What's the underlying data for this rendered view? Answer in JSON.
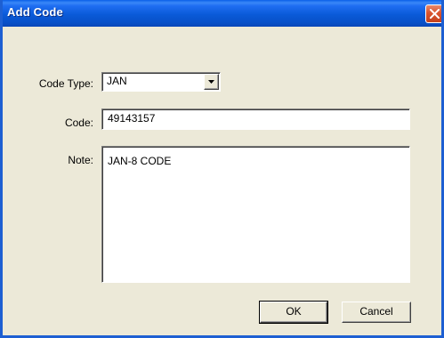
{
  "window": {
    "title": "Add Code"
  },
  "form": {
    "code_type_label": "Code Type:",
    "code_type_value": "JAN",
    "code_label": "Code:",
    "code_value": "49143157",
    "note_label": "Note:",
    "note_value": "JAN-8 CODE"
  },
  "buttons": {
    "ok_label": "OK",
    "cancel_label": "Cancel"
  },
  "icons": {
    "close": "close-icon",
    "dropdown": "chevron-down-icon"
  },
  "colors": {
    "titlebar": "#0a5ad8",
    "dialog_background": "#ece9d8",
    "close_button": "#d9542d"
  }
}
